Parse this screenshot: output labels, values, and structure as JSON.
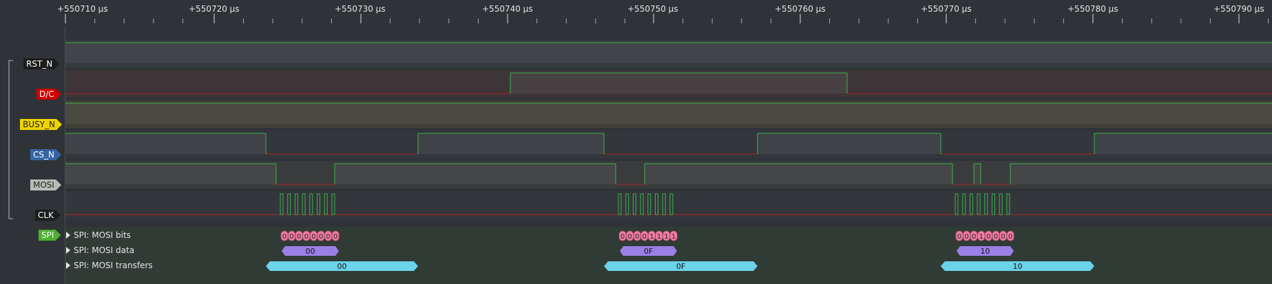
{
  "ruler": {
    "labels": [
      "+550710 µs",
      "+550720 µs",
      "+550730 µs",
      "+550740 µs",
      "+550750 µs",
      "+550760 µs",
      "+550770 µs",
      "+550780 µs",
      "+550790 µs"
    ]
  },
  "channels": [
    {
      "name": "RST_N",
      "color": "#1c1c1c"
    },
    {
      "name": "D/C",
      "color": "#cc0000"
    },
    {
      "name": "BUSY_N",
      "color": "#edd400"
    },
    {
      "name": "CS_N",
      "color": "#3465a4"
    },
    {
      "name": "MOSI",
      "color": "#babdb6"
    },
    {
      "name": "CLK",
      "color": "#1c1c1c"
    }
  ],
  "decoder": {
    "name": "SPI",
    "color": "#4caf30",
    "rows": [
      "SPI: MOSI bits",
      "SPI: MOSI data",
      "SPI: MOSI transfers"
    ]
  },
  "transfers": [
    {
      "bits": [
        "0",
        "0",
        "0",
        "0",
        "0",
        "0",
        "0",
        "0"
      ],
      "data": "00",
      "transfer": "00"
    },
    {
      "bits": [
        "0",
        "0",
        "0",
        "0",
        "1",
        "1",
        "1",
        "1"
      ],
      "data": "0F",
      "transfer": "0F"
    },
    {
      "bits": [
        "0",
        "0",
        "0",
        "1",
        "0",
        "0",
        "0",
        "0"
      ],
      "data": "10",
      "transfer": "10"
    }
  ],
  "colors": {
    "signal_high": "#3cb44a",
    "signal_low": "#b02020",
    "bits": "#ef7ea4",
    "data": "#9c7fe6",
    "transfers": "#6bd3e8"
  }
}
